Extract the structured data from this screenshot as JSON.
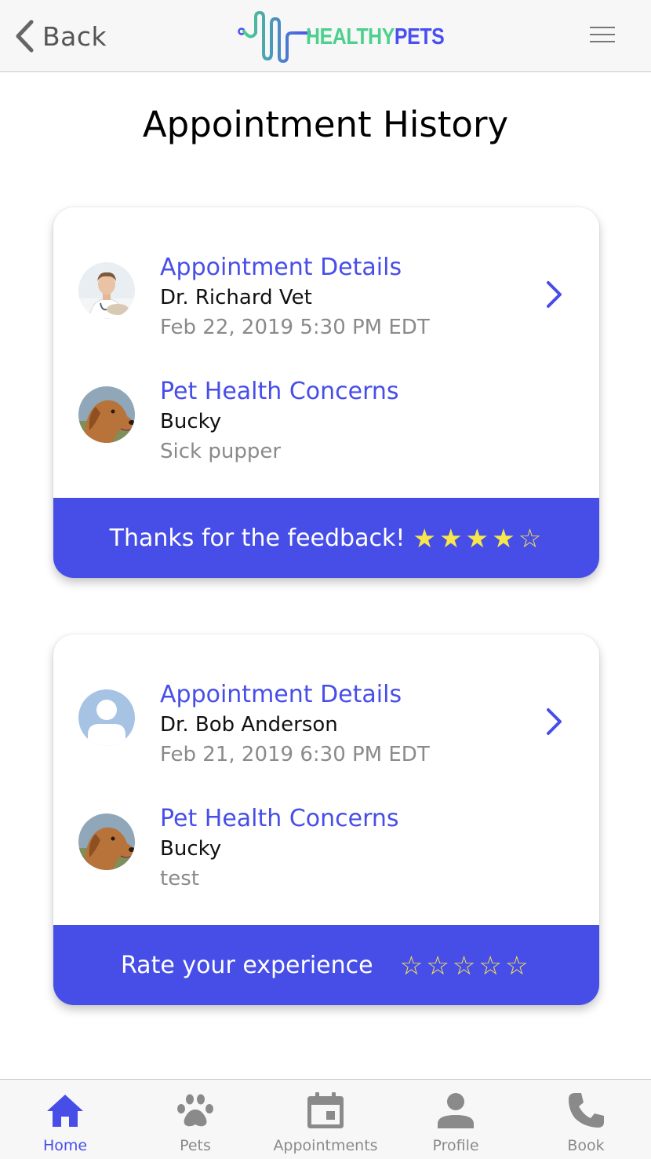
{
  "header": {
    "back_label": "Back",
    "logo_part1": "HEALTHY",
    "logo_part2": "PETS"
  },
  "page_title": "Appointment History",
  "appointments": [
    {
      "details_heading": "Appointment Details",
      "doctor": "Dr. Richard Vet",
      "datetime": "Feb 22, 2019 5:30 PM EDT",
      "concerns_heading": "Pet Health Concerns",
      "pet_name": "Bucky",
      "concern": "Sick pupper",
      "footer_text": "Thanks for the feedback!",
      "rating": 4,
      "max_rating": 5
    },
    {
      "details_heading": "Appointment Details",
      "doctor": "Dr. Bob Anderson",
      "datetime": "Feb 21, 2019 6:30 PM EDT",
      "concerns_heading": "Pet Health Concerns",
      "pet_name": "Bucky",
      "concern": "test",
      "footer_text": "Rate your experience",
      "rating": 0,
      "max_rating": 5
    }
  ],
  "bottom_nav": [
    {
      "label": "Home",
      "icon": "home-icon",
      "active": true
    },
    {
      "label": "Pets",
      "icon": "paw-icon",
      "active": false
    },
    {
      "label": "Appointments",
      "icon": "calendar-icon",
      "active": false
    },
    {
      "label": "Profile",
      "icon": "person-icon",
      "active": false
    },
    {
      "label": "Book",
      "icon": "phone-icon",
      "active": false
    }
  ],
  "colors": {
    "accent": "#474ee8",
    "logo_green": "#4bd08e",
    "star": "#f7e64c",
    "nav_inactive": "#8a8a8a"
  }
}
